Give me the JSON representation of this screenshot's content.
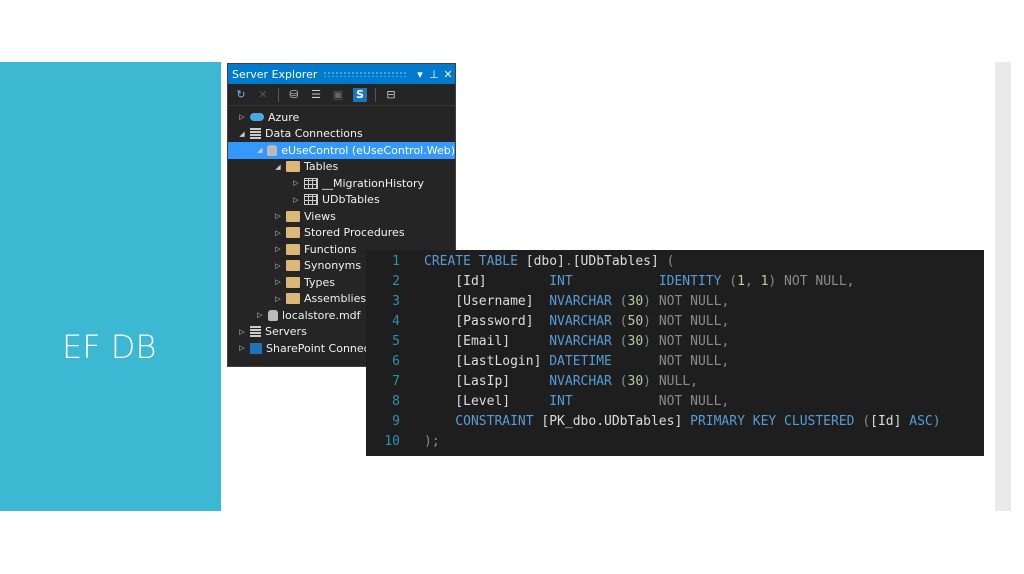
{
  "slide": {
    "title": "EF DB"
  },
  "server_explorer": {
    "title": "Server Explorer",
    "title_buttons": [
      "▾",
      "⊥",
      "✕"
    ],
    "toolbar": [
      "refresh-icon",
      "stop-icon",
      "connect-database-icon",
      "connect-server-icon",
      "add-sharepoint-icon",
      "sharepoint-icon",
      "properties-icon"
    ],
    "tree": [
      {
        "label": "Azure",
        "level": 0,
        "arrow": "▷",
        "icon": "cloud"
      },
      {
        "label": "Data Connections",
        "level": 0,
        "arrow": "◢",
        "icon": "srv"
      },
      {
        "label": "eUseControl (eUseControl.Web)",
        "level": 1,
        "arrow": "◢",
        "icon": "db",
        "selected": true
      },
      {
        "label": "Tables",
        "level": 2,
        "arrow": "◢",
        "icon": "folder"
      },
      {
        "label": "__MigrationHistory",
        "level": 3,
        "arrow": "▷",
        "icon": "tableic"
      },
      {
        "label": "UDbTables",
        "level": 3,
        "arrow": "▷",
        "icon": "tableic"
      },
      {
        "label": "Views",
        "level": 2,
        "arrow": "▷",
        "icon": "folder"
      },
      {
        "label": "Stored Procedures",
        "level": 2,
        "arrow": "▷",
        "icon": "folder"
      },
      {
        "label": "Functions",
        "level": 2,
        "arrow": "▷",
        "icon": "folder"
      },
      {
        "label": "Synonyms",
        "level": 2,
        "arrow": "▷",
        "icon": "folder"
      },
      {
        "label": "Types",
        "level": 2,
        "arrow": "▷",
        "icon": "folder"
      },
      {
        "label": "Assemblies",
        "level": 2,
        "arrow": "▷",
        "icon": "folder"
      },
      {
        "label": "localstore.mdf",
        "level": 1,
        "arrow": "▷",
        "icon": "db"
      },
      {
        "label": "Servers",
        "level": 0,
        "arrow": "▷",
        "icon": "srv"
      },
      {
        "label": "SharePoint Connections",
        "level": 0,
        "arrow": "▷",
        "icon": "sp"
      }
    ]
  },
  "code": {
    "lines": [
      [
        [
          "CREATE TABLE ",
          "kw"
        ],
        [
          "[dbo]",
          "id"
        ],
        [
          ".",
          "gr"
        ],
        [
          "[UDbTables]",
          "id"
        ],
        [
          " (",
          "gr"
        ]
      ],
      [
        [
          "    [Id]        ",
          "id"
        ],
        [
          "INT",
          "kw"
        ],
        [
          "           ",
          ""
        ],
        [
          "IDENTITY",
          "kw"
        ],
        [
          " (",
          "gr"
        ],
        [
          "1",
          "nu"
        ],
        [
          ", ",
          "gr"
        ],
        [
          "1",
          "nu"
        ],
        [
          ") NOT NULL,",
          "gr"
        ]
      ],
      [
        [
          "    [Username]  ",
          "id"
        ],
        [
          "NVARCHAR",
          "kw"
        ],
        [
          " (",
          "gr"
        ],
        [
          "30",
          "nu"
        ],
        [
          ") NOT NULL,",
          "gr"
        ]
      ],
      [
        [
          "    [Password]  ",
          "id"
        ],
        [
          "NVARCHAR",
          "kw"
        ],
        [
          " (",
          "gr"
        ],
        [
          "50",
          "nu"
        ],
        [
          ") NOT NULL,",
          "gr"
        ]
      ],
      [
        [
          "    [Email]     ",
          "id"
        ],
        [
          "NVARCHAR",
          "kw"
        ],
        [
          " (",
          "gr"
        ],
        [
          "30",
          "nu"
        ],
        [
          ") NOT NULL,",
          "gr"
        ]
      ],
      [
        [
          "    [LastLogin] ",
          "id"
        ],
        [
          "DATETIME",
          "kw"
        ],
        [
          "      NOT NULL,",
          "gr"
        ]
      ],
      [
        [
          "    [LasIp]     ",
          "id"
        ],
        [
          "NVARCHAR",
          "kw"
        ],
        [
          " (",
          "gr"
        ],
        [
          "30",
          "nu"
        ],
        [
          ") NULL,",
          "gr"
        ]
      ],
      [
        [
          "    [Level]     ",
          "id"
        ],
        [
          "INT",
          "kw"
        ],
        [
          "           NOT NULL,",
          "gr"
        ]
      ],
      [
        [
          "    CONSTRAINT ",
          "kw"
        ],
        [
          "[PK_dbo.UDbTables]",
          "id"
        ],
        [
          " PRIMARY KEY CLUSTERED ",
          "kw"
        ],
        [
          "(",
          "gr"
        ],
        [
          "[Id]",
          "id"
        ],
        [
          " ASC)",
          "kw"
        ]
      ],
      [
        [
          ");",
          "gr"
        ]
      ]
    ]
  }
}
